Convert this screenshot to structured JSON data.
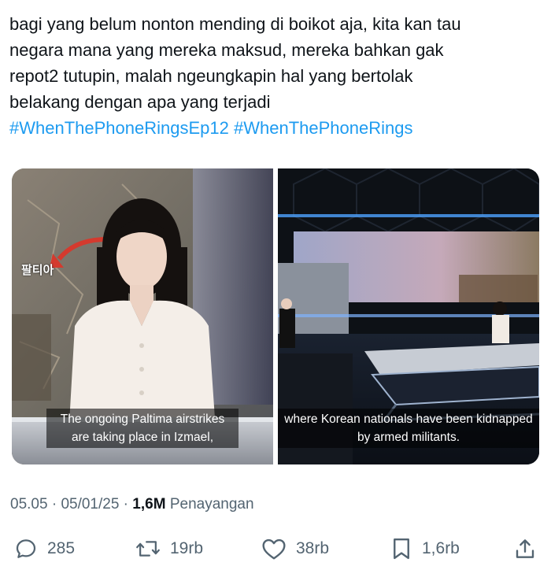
{
  "tweet": {
    "text_lines": [
      "bagi yang belum nonton mending di boikot aja, kita kan tau",
      "negara mana yang mereka maksud, mereka bahkan gak",
      "repot2 tutupin, malah ngeungkapin hal yang bertolak",
      "belakang dengan apa yang terjadi"
    ],
    "hashtags": [
      "#WhenThePhoneRingsEp12",
      "#WhenThePhoneRings"
    ]
  },
  "media": {
    "left": {
      "map_label": "팔티아",
      "subtitle_lines": [
        "The ongoing Paltima airstrikes",
        "are taking place in Izmael,"
      ]
    },
    "right": {
      "subtitle_lines": [
        "where Korean nationals have been kidnapped",
        "by armed militants."
      ]
    }
  },
  "meta": {
    "time": "05.05",
    "separator1": " · ",
    "date": "05/01/25",
    "separator2": " · ",
    "views_count": "1,6M",
    "views_label": " Penayangan"
  },
  "actions": {
    "reply": {
      "icon": "reply-icon",
      "count": "285"
    },
    "retweet": {
      "icon": "retweet-icon",
      "count": "19rb"
    },
    "like": {
      "icon": "heart-icon",
      "count": "38rb"
    },
    "bookmark": {
      "icon": "bookmark-icon",
      "count": "1,6rb"
    },
    "share": {
      "icon": "share-icon"
    }
  },
  "colors": {
    "text": "#0f1419",
    "secondary": "#536471",
    "link": "#1d9bf0"
  }
}
